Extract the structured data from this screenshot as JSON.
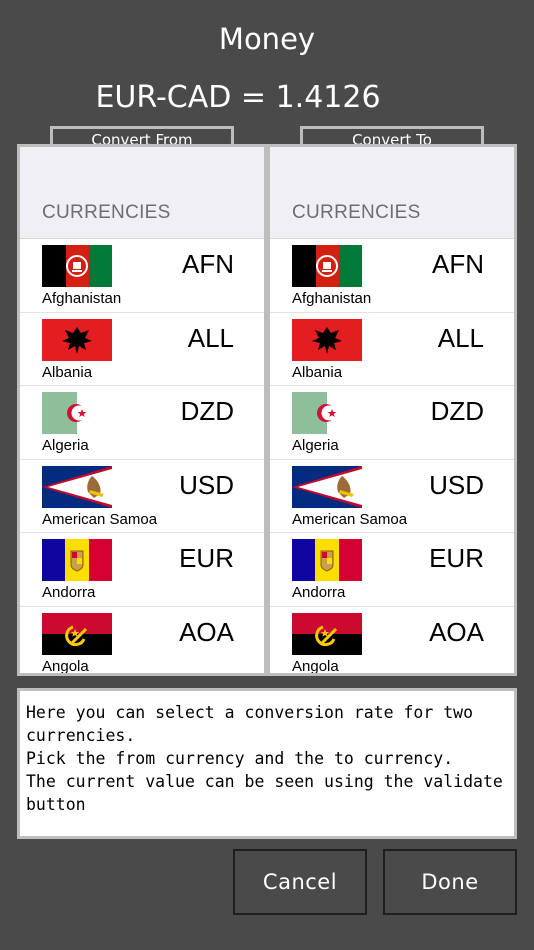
{
  "header": {
    "title": "Money",
    "rate_text": "EUR-CAD = 1.4126"
  },
  "tabs": {
    "from_label": "Convert From",
    "to_label": "Convert To"
  },
  "panels": {
    "section_label": "CURRENCIES",
    "items": [
      {
        "code": "AFN",
        "country": "Afghanistan",
        "flag": "afghanistan-flag"
      },
      {
        "code": "ALL",
        "country": "Albania",
        "flag": "albania-flag"
      },
      {
        "code": "DZD",
        "country": "Algeria",
        "flag": "algeria-flag"
      },
      {
        "code": "USD",
        "country": "American Samoa",
        "flag": "american-samoa-flag"
      },
      {
        "code": "EUR",
        "country": "Andorra",
        "flag": "andorra-flag"
      },
      {
        "code": "AOA",
        "country": "Angola",
        "flag": "angola-flag"
      }
    ]
  },
  "info": {
    "text": "Here you can select a conversion rate for two currencies.\nPick the from currency and the to currency.\nThe current value can be seen using the validate button"
  },
  "buttons": {
    "cancel_label": "Cancel",
    "done_label": "Done"
  },
  "colors": {
    "background": "#4a4a4a",
    "panel_border": "#bdbdbd",
    "header_bg": "#efeff4",
    "section_text": "#6d6d72"
  }
}
